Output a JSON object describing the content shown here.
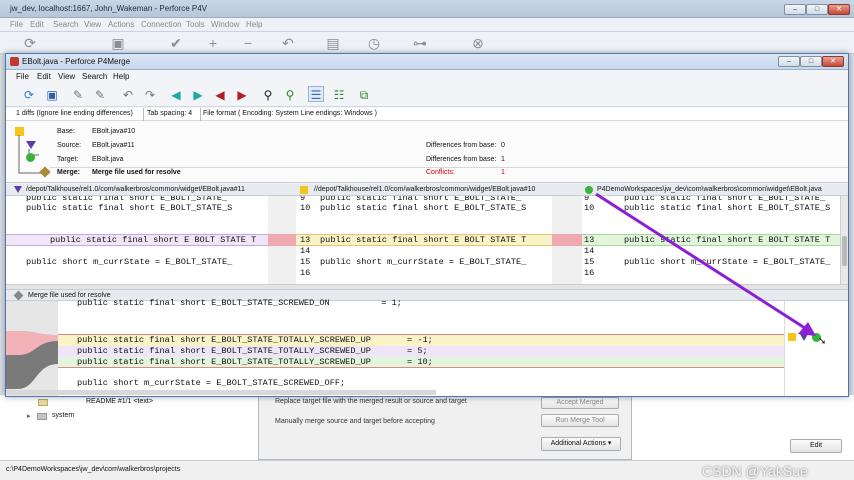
{
  "outer": {
    "title": "jw_dev,  localhost:1667,  John_Wakeman - Perforce P4V",
    "menu": [
      "File",
      "Edit",
      "Search",
      "View",
      "Actions",
      "Connection",
      "Tools",
      "Window",
      "Help"
    ],
    "tree": [
      {
        "label": "README #1/1 <text>"
      },
      {
        "label": "system"
      }
    ],
    "panel": {
      "rows": [
        {
          "text": "Replace target file with the merged result or source and target",
          "button": "Accept Merged"
        },
        {
          "text": "Manually merge source and target before accepting",
          "button": "Run Merge Tool"
        }
      ],
      "dropdown": "Additional Actions"
    },
    "edit_button": "Edit",
    "status_path": "c:\\P4DemoWorkspaces\\jw_dev\\com\\walkerbros\\projects",
    "watermark": "CSDN @YakSue"
  },
  "merge": {
    "title": "EBolt.java - Perforce P4Merge",
    "menu": [
      "File",
      "Edit",
      "View",
      "Search",
      "Help"
    ],
    "info": [
      "1 diffs (Ignore line ending differences)",
      "Tab spacing: 4",
      "File format ( Encoding: System  Line endings: Windows )"
    ],
    "files": {
      "base_label": "Base:",
      "base": "EBolt.java#10",
      "source_label": "Source:",
      "source": "EBolt.java#11",
      "target_label": "Target:",
      "target": "EBolt.java",
      "merge_label": "Merge:",
      "merge": "Merge file used for resolve",
      "src_diff_label": "Differences from base:",
      "src_diff": "0",
      "tgt_diff_label": "Differences from base:",
      "tgt_diff": "1",
      "conflicts_label": "Conflicts:",
      "conflicts": "1"
    },
    "panes": [
      {
        "header": "/depot/Talkhouse/rel1.0/com/walkerbros/common/widget/EBolt.java#11",
        "nums": [
          "9",
          "10",
          "",
          "13",
          "14",
          "15",
          "16"
        ],
        "lines": [
          "public static final short E_BOLT_STATE_",
          "public static final short E_BOLT_STATE_S",
          "",
          "public static final short E BOLT STATE T",
          "",
          "public short m_currState = E_BOLT_STATE_",
          ""
        ]
      },
      {
        "header": "//depot/Talkhouse/rel1.0/com/walkerbros/common/widget/EBolt.java#10",
        "nums": [
          "9",
          "10",
          "",
          "13",
          "14",
          "15",
          "16"
        ],
        "lines": [
          "public static final short E_BOLT_STATE_",
          "public static final short E_BOLT_STATE_S",
          "",
          "public static final short E BOLT STATE T",
          "",
          "public short m_currState = E_BOLT_STATE_",
          ""
        ]
      },
      {
        "header": "P4DemoWorkspaces\\jw_dev\\com\\walkerbros\\common\\widget\\EBolt.java",
        "nums": [
          "9",
          "10",
          "",
          "13",
          "14",
          "15",
          "16"
        ],
        "lines": [
          "public static final short E_BOLT_STATE_",
          "public static final short E_BOLT_STATE_S",
          "",
          "public static final short E BOLT STATE T",
          "",
          "public short m_currState = E_BOLT_STATE_",
          ""
        ]
      }
    ],
    "merge_header": "Merge file used for resolve",
    "merge_lines": [
      "public static final short E_BOLT_STATE_SCREWED_ON          = 1;",
      "",
      "public static final short E_BOLT_STATE_TOTALLY_SCREWED_UP       = -1;",
      "public static final short E_BOLT_STATE_TOTALLY_SCREWED_UP       = 5;",
      "public static final short E_BOLT_STATE_TOTALLY_SCREWED_UP       = 10;",
      "",
      "public short m_currState = E_BOLT_STATE_SCREWED_OFF;"
    ]
  },
  "colors": {
    "base": "#f5c518",
    "source": "#5b3fa8",
    "target": "#3bb33b",
    "arrow": "#8a1fd6",
    "conflict": "#cc0000"
  }
}
